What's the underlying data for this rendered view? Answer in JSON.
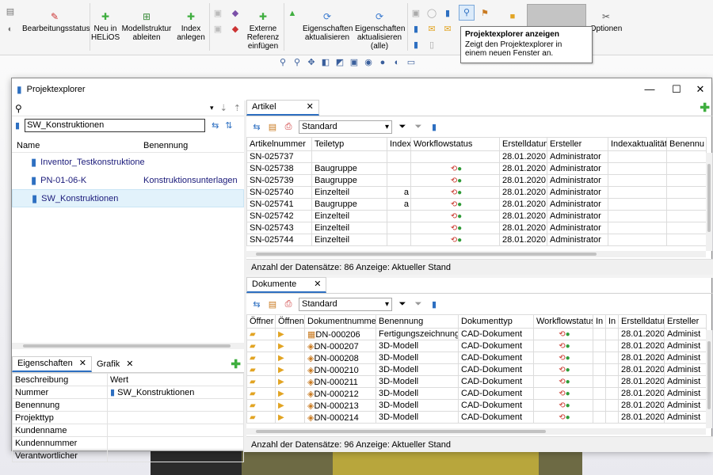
{
  "ribbon": {
    "bearbeitungsstatus": "Bearbeitungsstatus",
    "neu_helios": [
      "Neu in",
      "HELiOS"
    ],
    "modellstruktur": [
      "Modellstruktur",
      "ableiten"
    ],
    "index": [
      "Index",
      "anlegen"
    ],
    "externe": [
      "Externe",
      "Referenz",
      "einfügen"
    ],
    "eigenschaften": [
      "Eigenschaften",
      "aktualisieren"
    ],
    "eigenschaften_alle": [
      "Eigenschaften",
      "aktualisieren",
      "(alle)"
    ],
    "optionen": "Optionen"
  },
  "tooltip": {
    "title": "Projektexplorer anzeigen",
    "line1": "Zeigt den Projektexplorer in",
    "line2": "einem neuen Fenster an."
  },
  "window": {
    "title": "Projektexplorer"
  },
  "left": {
    "path_value": "SW_Konstruktionen",
    "tree_headers": [
      "Name",
      "Benennung"
    ],
    "tree_items": [
      {
        "name": "Inventor_Testkonstruktione",
        "benennung": ""
      },
      {
        "name": "PN-01-06-K",
        "benennung": "Konstruktionsunterlagen"
      },
      {
        "name": "SW_Konstruktionen",
        "benennung": ""
      }
    ],
    "tabs": [
      "Eigenschaften",
      "Grafik"
    ],
    "props_headers": [
      "Beschreibung",
      "Wert"
    ],
    "props": [
      {
        "k": "Nummer",
        "v": "SW_Konstruktionen"
      },
      {
        "k": "Benennung",
        "v": ""
      },
      {
        "k": "Projekttyp",
        "v": ""
      },
      {
        "k": "Kundenname",
        "v": ""
      },
      {
        "k": "Kundennummer",
        "v": ""
      },
      {
        "k": "Verantwortlicher",
        "v": ""
      }
    ]
  },
  "artikel": {
    "tab": "Artikel",
    "view": "Standard",
    "headers": [
      "Artikelnummer",
      "Teiletyp",
      "Index",
      "Workflowstatus",
      "Erstelldatum",
      "Ersteller",
      "Indexaktualität",
      "Benennu"
    ],
    "rows": [
      [
        "SN-025737",
        "",
        "",
        "",
        "28.01.2020",
        "Administrator"
      ],
      [
        "SN-025738",
        "Baugruppe",
        "",
        "",
        "28.01.2020",
        "Administrator"
      ],
      [
        "SN-025739",
        "Baugruppe",
        "",
        "",
        "28.01.2020",
        "Administrator"
      ],
      [
        "SN-025740",
        "Einzelteil",
        "a",
        "",
        "28.01.2020",
        "Administrator"
      ],
      [
        "SN-025741",
        "Baugruppe",
        "a",
        "",
        "28.01.2020",
        "Administrator"
      ],
      [
        "SN-025742",
        "Einzelteil",
        "",
        "",
        "28.01.2020",
        "Administrator"
      ],
      [
        "SN-025743",
        "Einzelteil",
        "",
        "",
        "28.01.2020",
        "Administrator"
      ],
      [
        "SN-025744",
        "Einzelteil",
        "",
        "",
        "28.01.2020",
        "Administrator"
      ]
    ],
    "status": "Anzahl der Datensätze: 86   Anzeige: Aktueller Stand"
  },
  "dokumente": {
    "tab": "Dokumente",
    "view": "Standard",
    "headers": [
      "Öffner",
      "Öffnen",
      "Dokumentnummer",
      "Benennung",
      "Dokumenttyp",
      "Workflowstatus",
      "In",
      "In",
      "Erstelldatum",
      "Ersteller"
    ],
    "rows": [
      [
        "DN-000206",
        "Fertigungszeichnung",
        "CAD-Dokument",
        "28.01.2020",
        "Administ"
      ],
      [
        "DN-000207",
        "3D-Modell",
        "CAD-Dokument",
        "28.01.2020",
        "Administ"
      ],
      [
        "DN-000208",
        "3D-Modell",
        "CAD-Dokument",
        "28.01.2020",
        "Administ"
      ],
      [
        "DN-000210",
        "3D-Modell",
        "CAD-Dokument",
        "28.01.2020",
        "Administ"
      ],
      [
        "DN-000211",
        "3D-Modell",
        "CAD-Dokument",
        "28.01.2020",
        "Administ"
      ],
      [
        "DN-000212",
        "3D-Modell",
        "CAD-Dokument",
        "28.01.2020",
        "Administ"
      ],
      [
        "DN-000213",
        "3D-Modell",
        "CAD-Dokument",
        "28.01.2020",
        "Administ"
      ],
      [
        "DN-000214",
        "3D-Modell",
        "CAD-Dokument",
        "28.01.2020",
        "Administ"
      ]
    ],
    "status": "Anzahl der Datensätze: 96   Anzeige: Aktueller Stand"
  }
}
